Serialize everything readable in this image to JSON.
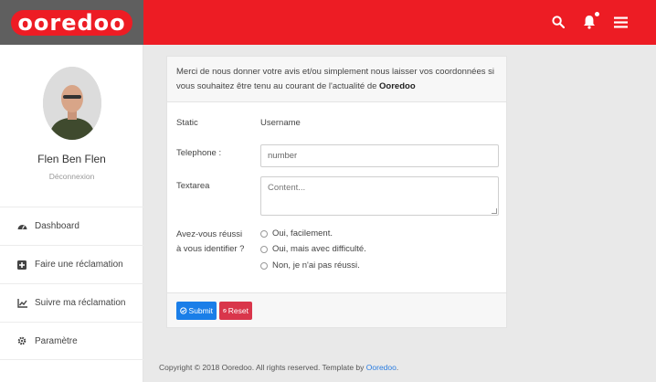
{
  "brand": {
    "logo_text": "ooredoo"
  },
  "header": {
    "icons": [
      "search-icon",
      "bell-icon",
      "menu-icon"
    ]
  },
  "user": {
    "name": "Flen Ben Flen",
    "logout": "Déconnexion"
  },
  "sidebar": {
    "items": [
      {
        "label": "Dashboard",
        "icon": "dashboard-icon"
      },
      {
        "label": "Faire une réclamation",
        "icon": "plus-square-icon"
      },
      {
        "label": "Suivre ma réclamation",
        "icon": "chart-icon"
      },
      {
        "label": "Paramètre",
        "icon": "gear-icon"
      }
    ]
  },
  "form": {
    "intro_text": "Merci de nous donner votre avis et/ou simplement nous laisser vos coordonnées si vous souhaitez être tenu au courant de l'actualité de",
    "intro_brand": "Ooredoo",
    "static_label": "Static",
    "static_value": "Username",
    "telephone_label": "Telephone :",
    "telephone_placeholder": "number",
    "textarea_label": "Textarea",
    "textarea_placeholder": "Content...",
    "question_line1": "Avez-vous réussi",
    "question_line2": "à vous identifier ?",
    "options": [
      "Oui, facilement.",
      "Oui, mais avec difficulté.",
      "Non, je n'ai pas réussi."
    ],
    "submit_label": "Submit",
    "reset_label": "Reset"
  },
  "footer": {
    "text": "Copyright © 2018 Ooredoo. All rights reserved. Template by",
    "link": "Ooredoo",
    "end": "."
  },
  "colors": {
    "brand_red": "#ed1c24",
    "brand_gray": "#5f5f5f",
    "submit_blue": "#1a7ee8",
    "reset_red": "#d9364b"
  }
}
